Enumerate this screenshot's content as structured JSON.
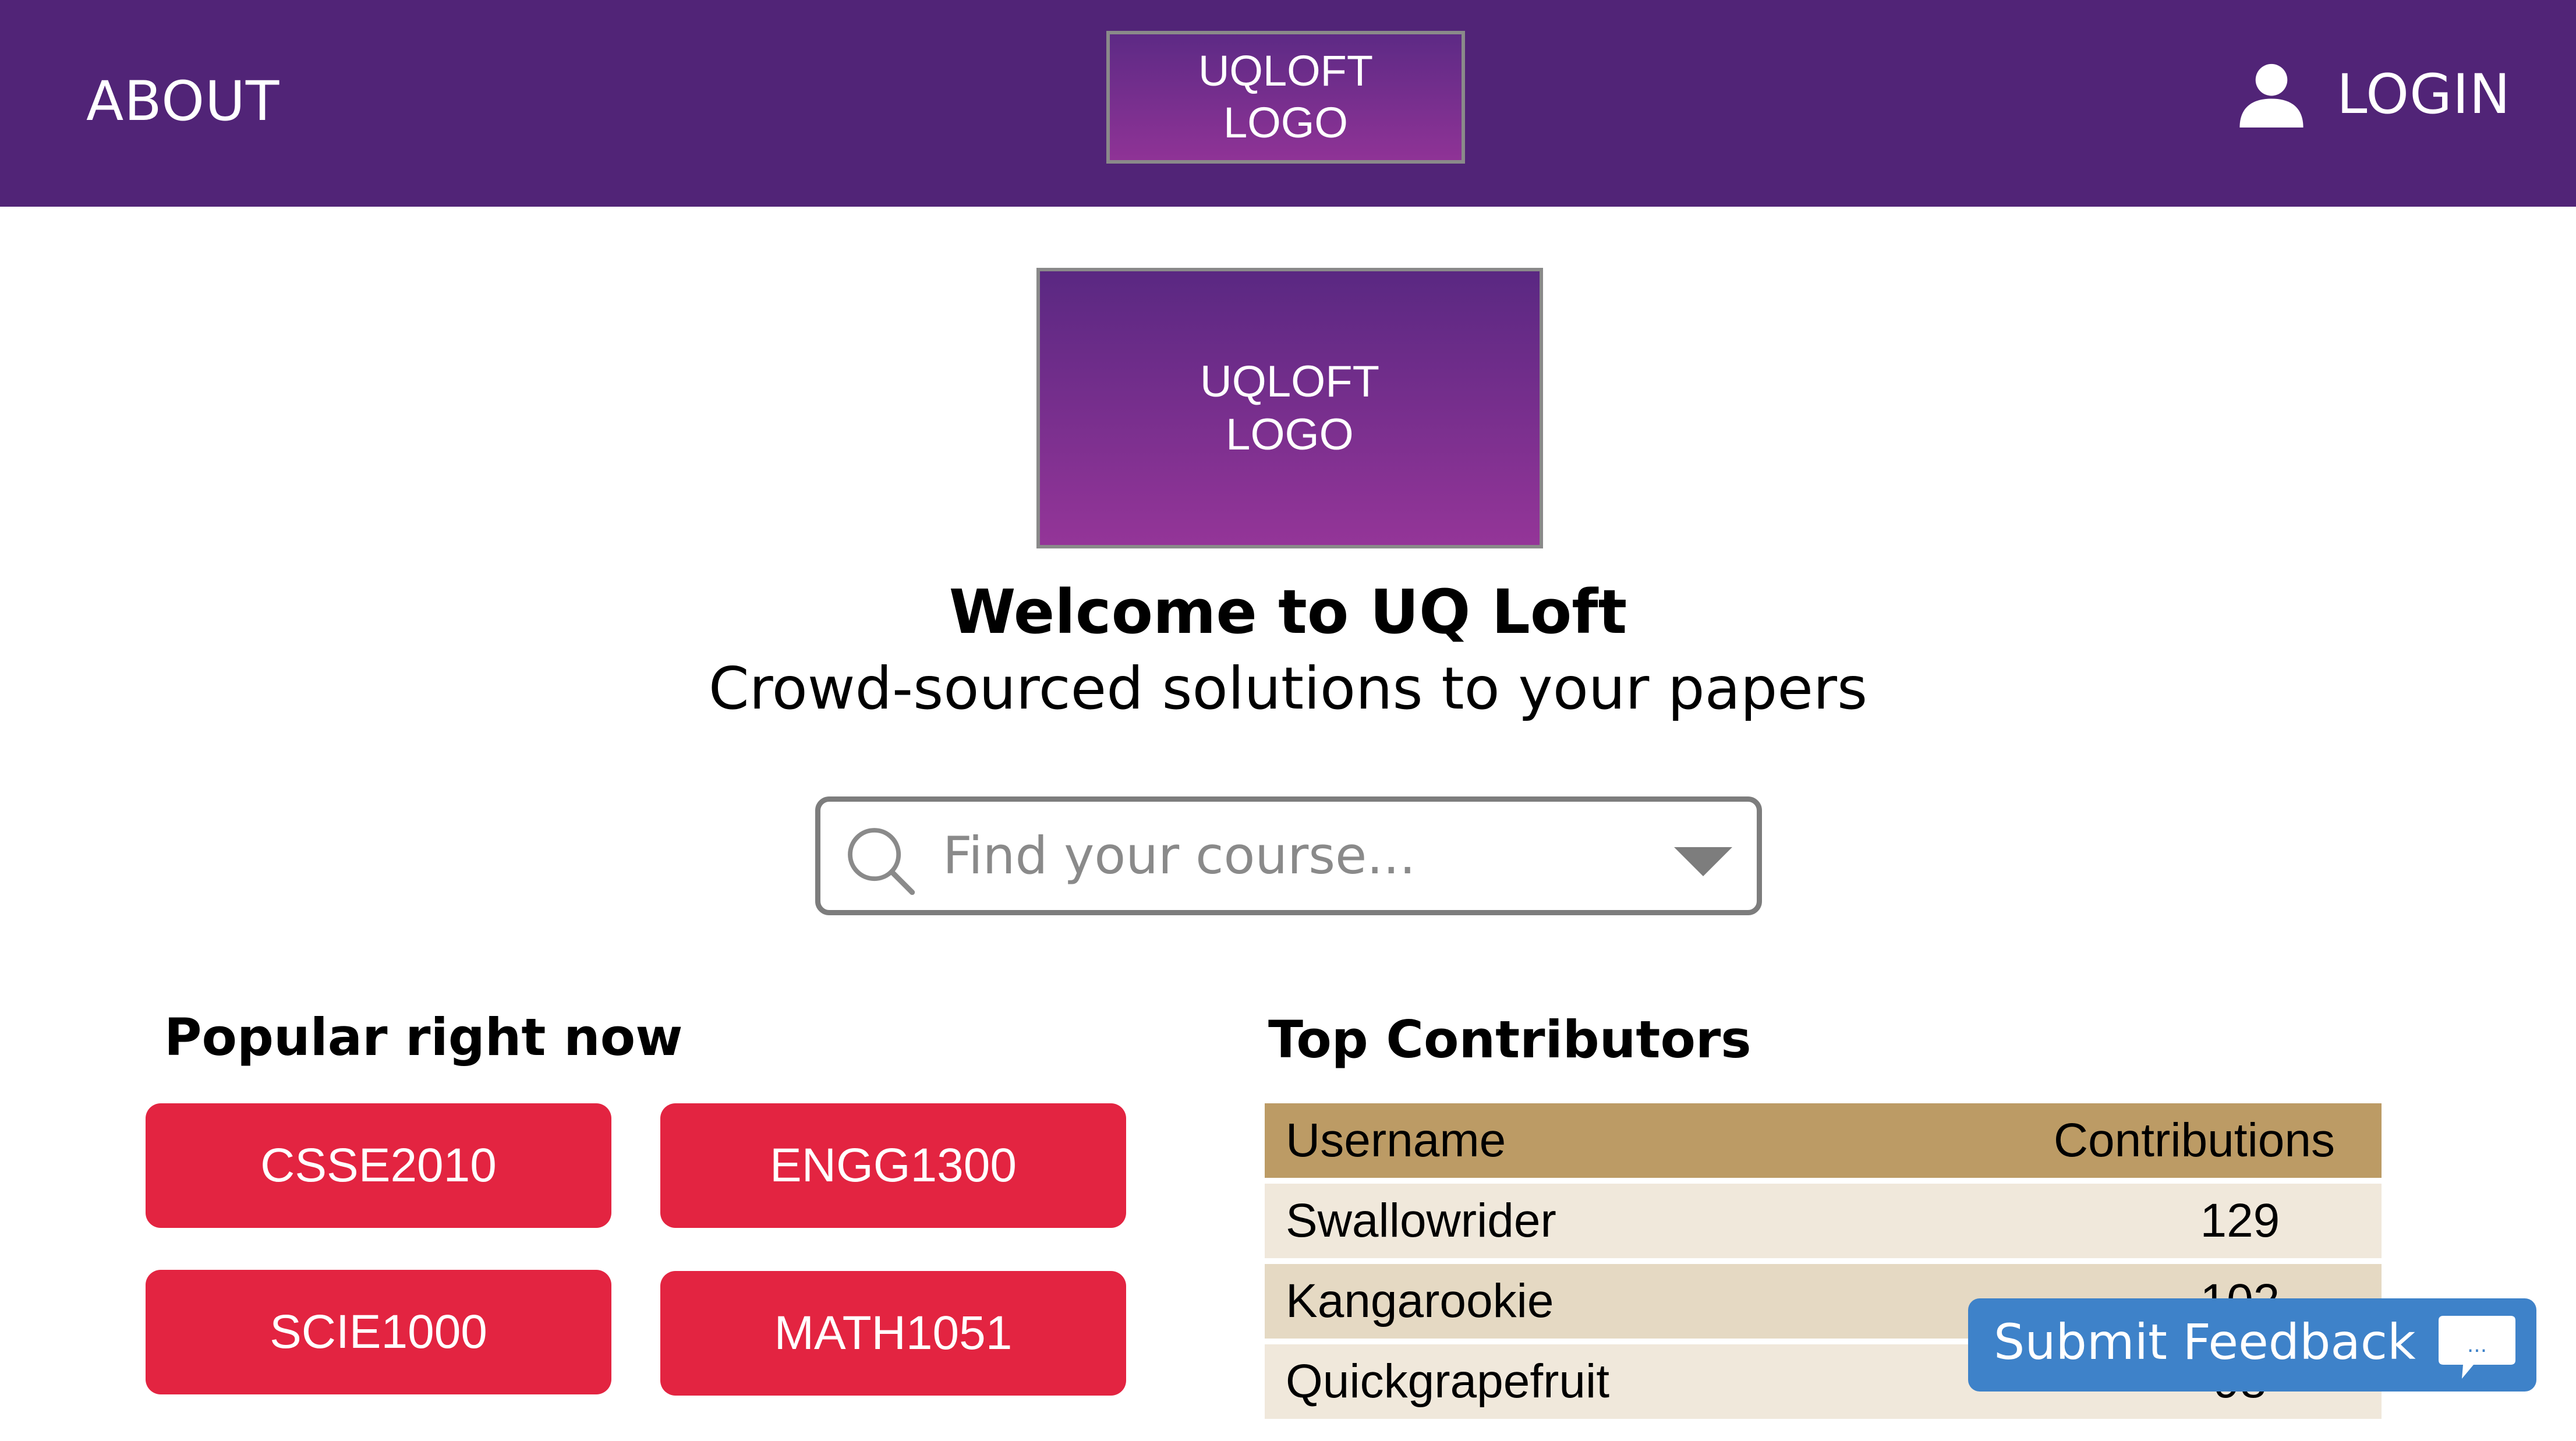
{
  "header": {
    "about_label": "ABOUT",
    "logo_line1": "UQLOFT",
    "logo_line2": "LOGO",
    "login_label": "LOGIN",
    "login_icon": "user-icon"
  },
  "hero": {
    "logo_line1": "UQLOFT",
    "logo_line2": "LOGO",
    "title": "Welcome to UQ Loft",
    "subtitle": "Crowd-sourced solutions to your papers"
  },
  "search": {
    "placeholder": "Find your course...",
    "value": "",
    "icon": "search-icon",
    "dropdown_icon": "triangle-down-icon"
  },
  "popular": {
    "title": "Popular right now",
    "courses": [
      "CSSE2010",
      "ENGG1300",
      "SCIE1000",
      "MATH1051"
    ]
  },
  "contributors": {
    "title": "Top Contributors",
    "columns": [
      "Username",
      "Contributions"
    ],
    "rows": [
      {
        "username": "Swallowrider",
        "contributions": "129"
      },
      {
        "username": "Kangarookie",
        "contributions": "102"
      },
      {
        "username": "Quickgrapefruit",
        "contributions": "98"
      }
    ]
  },
  "feedback": {
    "label": "Submit Feedback",
    "icon_text": "...",
    "icon": "chat-bubble-icon"
  },
  "colors": {
    "header_bg": "#512477",
    "logo_gradient_top": "#5a2882",
    "logo_gradient_bottom": "#943598",
    "course_button": "#e32441",
    "table_header": "#bc9b65",
    "table_row": "#f0e8db",
    "table_row_alt": "#e5d9c3",
    "feedback_button": "#3e82c9"
  }
}
